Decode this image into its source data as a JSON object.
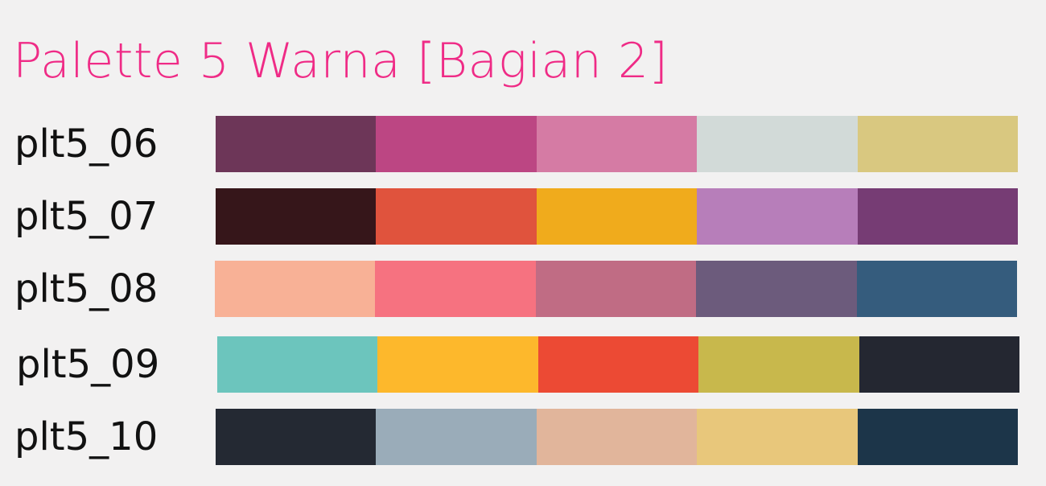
{
  "title": "Palette 5 Warna [Bagian 2]",
  "palettes": [
    {
      "name": "plt5_06",
      "colors": [
        "#6d3658",
        "#bc4683",
        "#d57ba4",
        "#d2dad8",
        "#d9c880"
      ]
    },
    {
      "name": "plt5_07",
      "colors": [
        "#36161a",
        "#e0533d",
        "#f0ab1c",
        "#b77eba",
        "#763c74"
      ]
    },
    {
      "name": "plt5_08",
      "colors": [
        "#f8b196",
        "#f67280",
        "#c06c84",
        "#6c5b7c",
        "#355c7d"
      ]
    },
    {
      "name": "plt5_09",
      "colors": [
        "#6cc5bd",
        "#fdb82c",
        "#ec4a34",
        "#c8b84c",
        "#242731"
      ]
    },
    {
      "name": "plt5_10",
      "colors": [
        "#242933",
        "#9aacb9",
        "#e1b59b",
        "#e8c77b",
        "#1c3549"
      ]
    }
  ]
}
